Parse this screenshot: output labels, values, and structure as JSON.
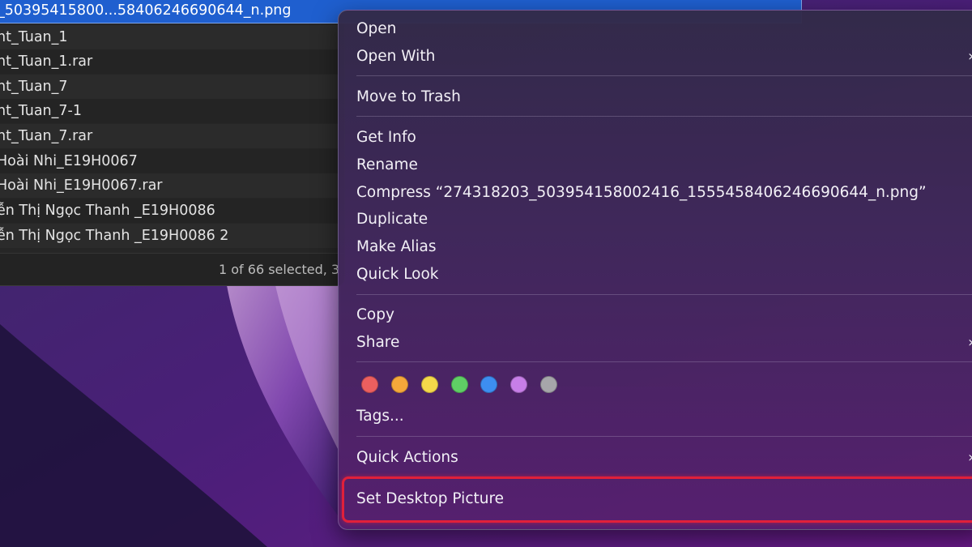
{
  "finder": {
    "selected_file": "_50395415800...58406246690644_n.png",
    "rows": [
      "nt_Tuan_1",
      "nt_Tuan_1.rar",
      "nt_Tuan_7",
      "nt_Tuan_7-1",
      "nt_Tuan_7.rar",
      " Hoài Nhi_E19H0067",
      " Hoài Nhi_E19H0067.rar",
      "ễn Thị Ngọc Thanh _E19H0086",
      "ễn Thị Ngọc Thanh _E19H0086 2"
    ],
    "status": "1 of 66 selected, 3"
  },
  "menu": {
    "open": "Open",
    "open_with": "Open With",
    "move_to_trash": "Move to Trash",
    "get_info": "Get Info",
    "rename": "Rename",
    "compress": "Compress “274318203_503954158002416_1555458406246690644_n.png”",
    "duplicate": "Duplicate",
    "make_alias": "Make Alias",
    "quick_look": "Quick Look",
    "copy": "Copy",
    "share": "Share",
    "tags": "Tags...",
    "quick_actions": "Quick Actions",
    "set_desktop_picture": "Set Desktop Picture",
    "submenu_chevron": "›",
    "tag_colors": [
      {
        "name": "red",
        "hex": "#ec5f5f"
      },
      {
        "name": "orange",
        "hex": "#f5a83a"
      },
      {
        "name": "yellow",
        "hex": "#f4d84a"
      },
      {
        "name": "green",
        "hex": "#5fce65"
      },
      {
        "name": "blue",
        "hex": "#3d8ef0"
      },
      {
        "name": "purple",
        "hex": "#c77ee8"
      },
      {
        "name": "gray",
        "hex": "#a6a6aa"
      }
    ]
  },
  "highlight_color": "#e0203a"
}
